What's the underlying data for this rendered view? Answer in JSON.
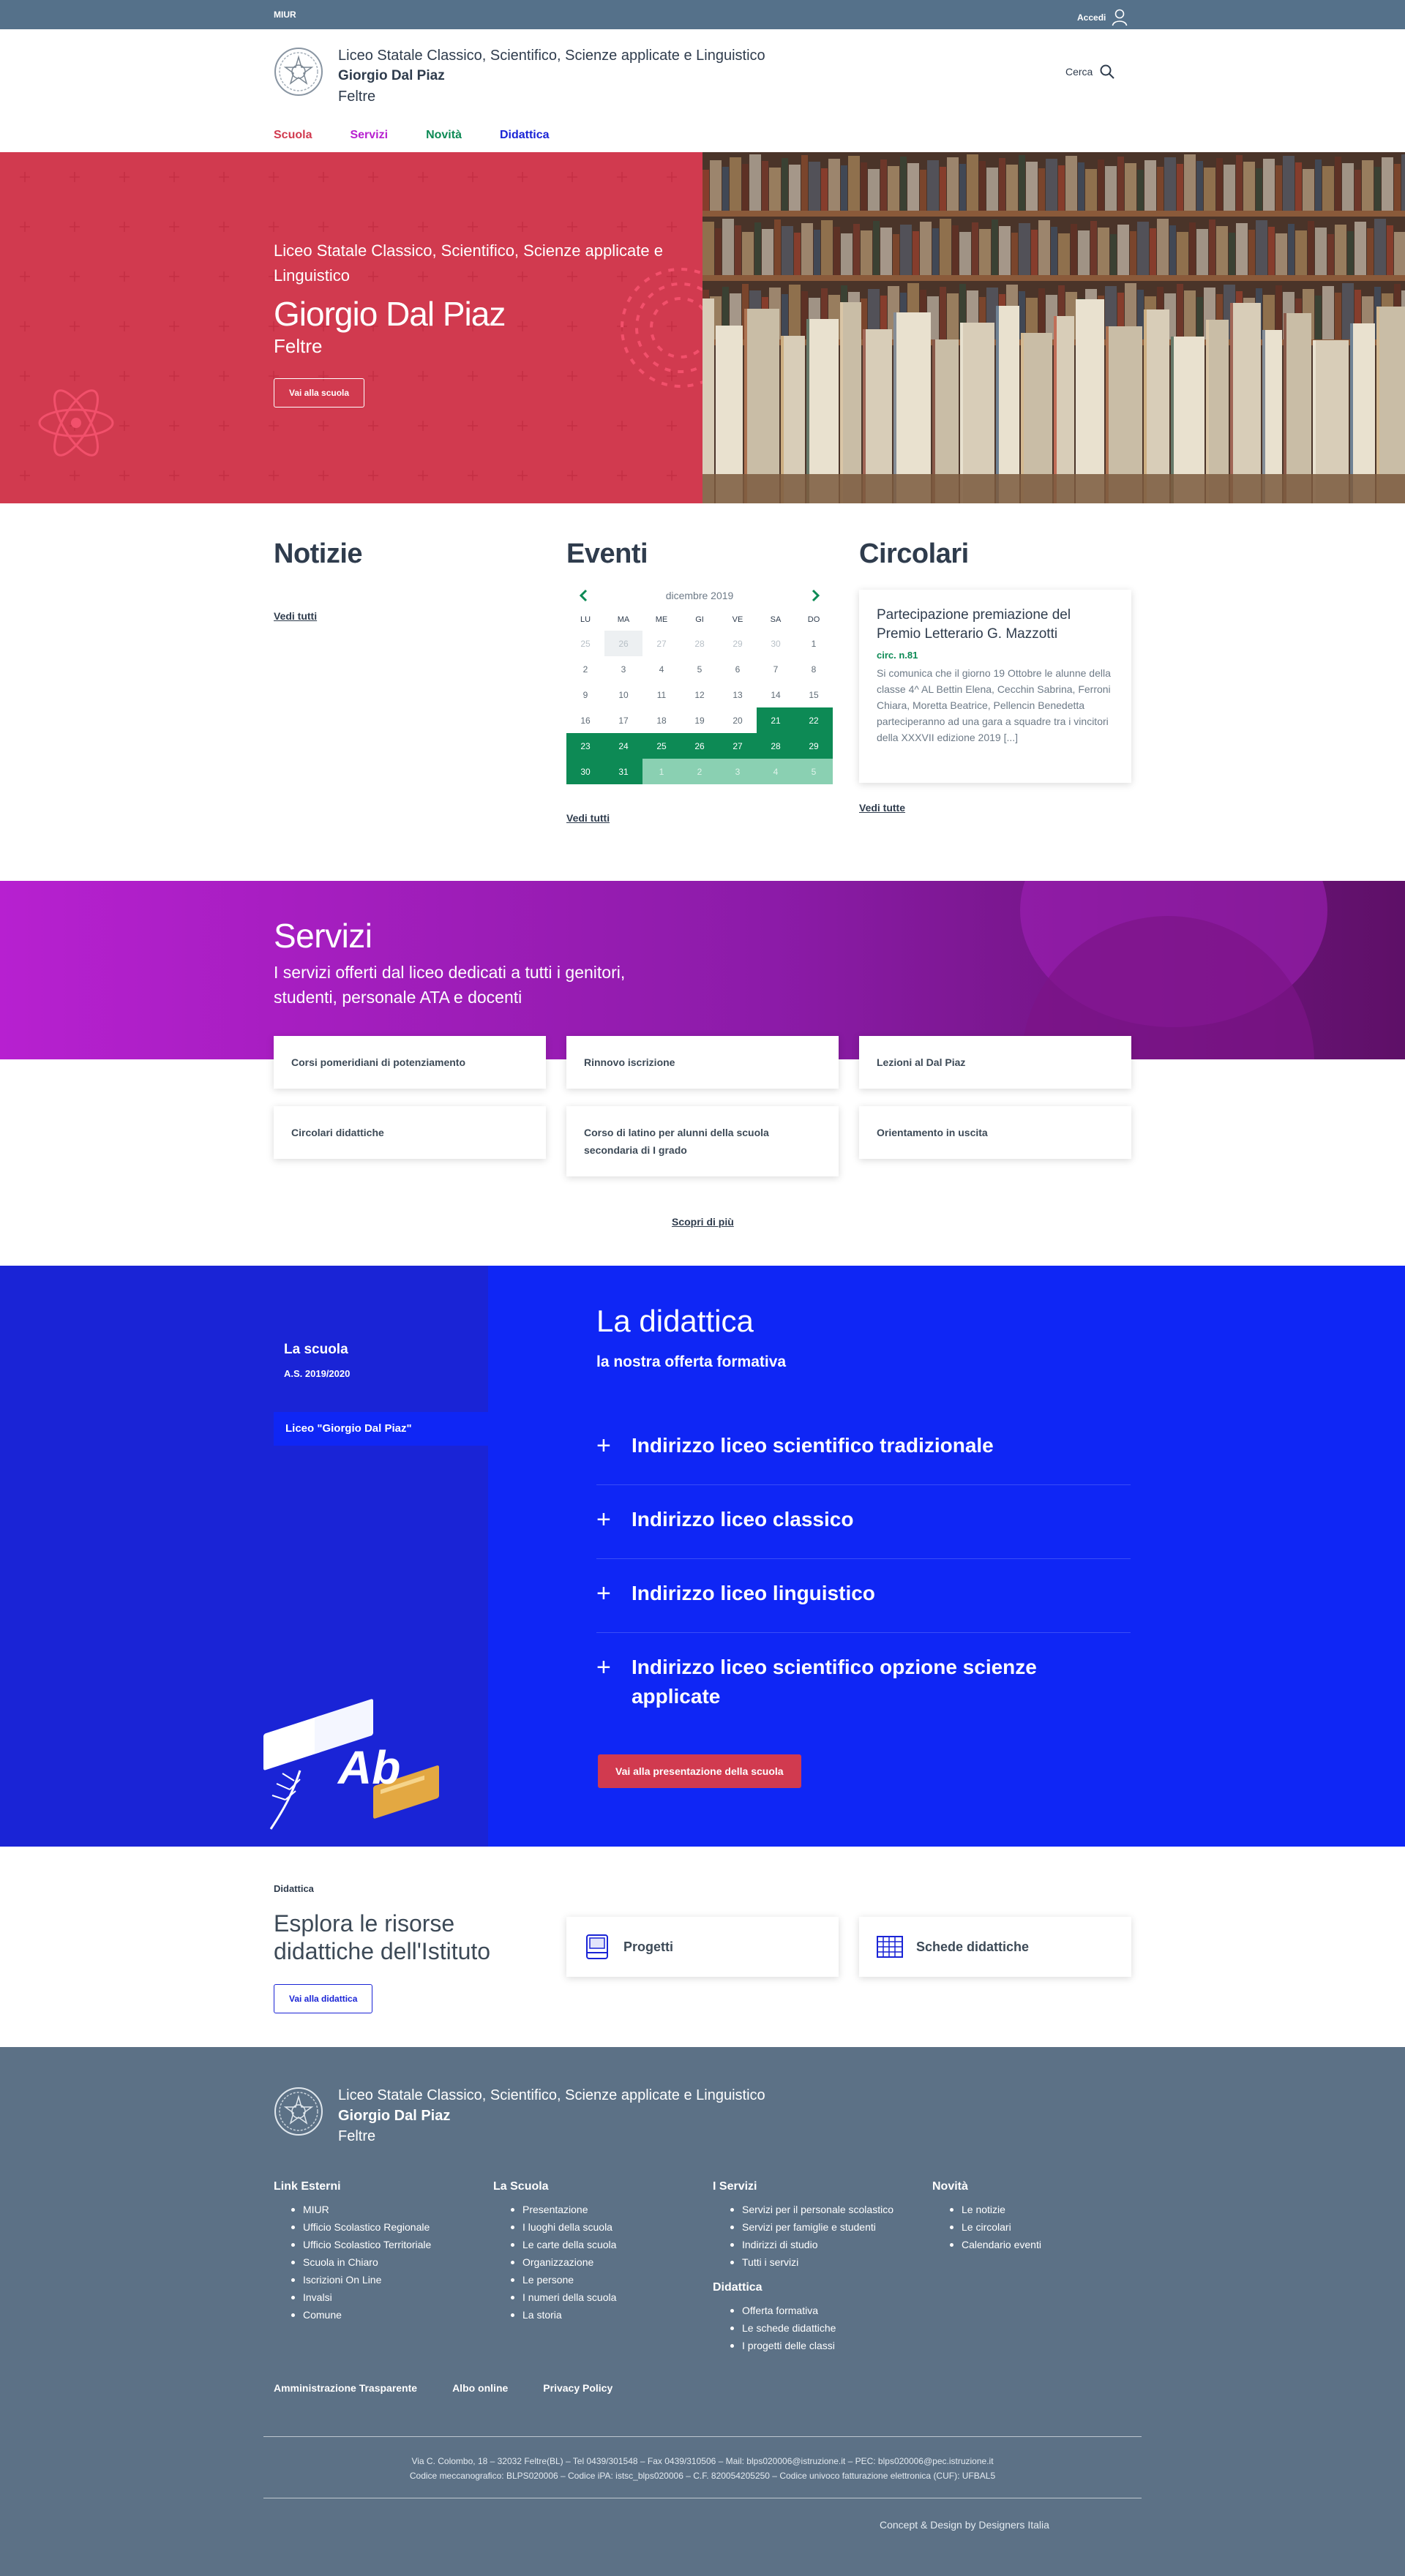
{
  "topbar": {
    "brand": "MIUR",
    "login": "Accedi"
  },
  "header": {
    "name_line1": "Liceo Statale Classico, Scientifico, Scienze applicate e Linguistico",
    "name_line2": "Giorgio Dal Piaz",
    "name_line3": "Feltre",
    "search": "Cerca"
  },
  "nav": [
    {
      "label": "Scuola",
      "color": "#d13a4f"
    },
    {
      "label": "Servizi",
      "color": "#b720d0"
    },
    {
      "label": "Novità",
      "color": "#0d8a55"
    },
    {
      "label": "Didattica",
      "color": "#1a24d6"
    }
  ],
  "hero": {
    "subtitle": "Liceo Statale Classico, Scientifico, Scienze applicate e Linguistico",
    "title": "Giorgio Dal Piaz",
    "city": "Feltre",
    "button": "Vai alla scuola"
  },
  "notizie": {
    "title": "Notizie",
    "link": "Vedi tutti"
  },
  "eventi": {
    "title": "Eventi",
    "month": "dicembre 2019",
    "days_of_week": [
      "LU",
      "MA",
      "ME",
      "GI",
      "VE",
      "SA",
      "DO"
    ],
    "weeks": [
      [
        "25",
        "26",
        "27",
        "28",
        "29",
        "30",
        "1"
      ],
      [
        "2",
        "3",
        "4",
        "5",
        "6",
        "7",
        "8"
      ],
      [
        "9",
        "10",
        "11",
        "12",
        "13",
        "14",
        "15"
      ],
      [
        "16",
        "17",
        "18",
        "19",
        "20",
        "21",
        "22"
      ],
      [
        "23",
        "24",
        "25",
        "26",
        "27",
        "28",
        "29"
      ],
      [
        "30",
        "31",
        "1",
        "2",
        "3",
        "4",
        "5"
      ]
    ],
    "link": "Vedi tutti"
  },
  "circolari": {
    "title": "Circolari",
    "card_title": "Partecipazione premiazione del Premio Letterario G. Mazzotti",
    "card_number": "circ. n.81",
    "card_text": "Si comunica che il giorno 19 Ottobre le alunne della classe 4^ AL Bettin Elena, Cecchin Sabrina, Ferroni Chiara, Moretta Beatrice, Pellencin Benedetta parteciperanno ad una gara a squadre tra i vincitori della XXXVII edizione 2019 [...]",
    "link": "Vedi tutte"
  },
  "servizi": {
    "title": "Servizi",
    "subtitle": "I servizi offerti dal liceo dedicati a tutti i genitori, studenti, personale ATA e docenti",
    "items": [
      "Corsi pomeridiani di potenziamento",
      "Rinnovo iscrizione",
      "Lezioni al Dal Piaz",
      "Circolari didattiche",
      "Corso di latino per alunni della scuola secondaria di I grado",
      "Orientamento in uscita"
    ],
    "link": "Scopri di più"
  },
  "didattica": {
    "side_title": "La scuola",
    "side_year": "A.S. 2019/2020",
    "side_tab": "Liceo \"Giorgio Dal Piaz\"",
    "title": "La didattica",
    "subtitle": "la nostra offerta formativa",
    "accordion": [
      "Indirizzo liceo scientifico tradizionale",
      "Indirizzo liceo classico",
      "Indirizzo liceo linguistico",
      "Indirizzo liceo scientifico opzione scienze applicate"
    ],
    "button": "Vai alla presentazione della scuola"
  },
  "risorse": {
    "kicker": "Didattica",
    "title": "Esplora le risorse didattiche dell'Istituto",
    "button": "Vai alla didattica",
    "cards": [
      "Progetti",
      "Schede didattiche"
    ]
  },
  "footer": {
    "name_line1": "Liceo Statale Classico, Scientifico, Scienze applicate e Linguistico",
    "name_line2": "Giorgio Dal Piaz",
    "name_line3": "Feltre",
    "columns": [
      {
        "title": "Link Esterni",
        "items": [
          "MIUR",
          "Ufficio Scolastico Regionale",
          "Ufficio Scolastico Territoriale",
          "Scuola in Chiaro",
          "Iscrizioni On Line",
          "Invalsi",
          "Comune"
        ]
      },
      {
        "title": "La Scuola",
        "items": [
          "Presentazione",
          "I luoghi della scuola",
          "Le carte della scuola",
          "Organizzazione",
          "Le persone",
          "I numeri della scuola",
          "La storia"
        ]
      },
      {
        "title": "I Servizi",
        "items": [
          "Servizi per il personale scolastico",
          "Servizi per famiglie e studenti",
          "Indirizzi di studio",
          "Tutti i servizi"
        ]
      },
      {
        "title": "Novità",
        "items": [
          "Le notizie",
          "Le circolari",
          "Calendario eventi"
        ]
      }
    ],
    "didattica_col": {
      "title": "Didattica",
      "items": [
        "Offerta formativa",
        "Le schede didattiche",
        "I progetti delle classi"
      ]
    },
    "bottom_links": [
      "Amministrazione Trasparente",
      "Albo online",
      "Privacy Policy"
    ],
    "address1": "Via C. Colombo, 18 – 32032 Feltre(BL) – Tel 0439/301548 – Fax 0439/310506 – Mail: blps020006@istruzione.it – PEC: blps020006@pec.istruzione.it",
    "address2": "Codice meccanografico: BLPS020006 – Codice iPA: istsc_blps020006 – C.F. 820054205250 – Codice univoco fatturazione elettronica (CUF): UFBAL5",
    "credit": "Concept & Design by Designers Italia"
  }
}
